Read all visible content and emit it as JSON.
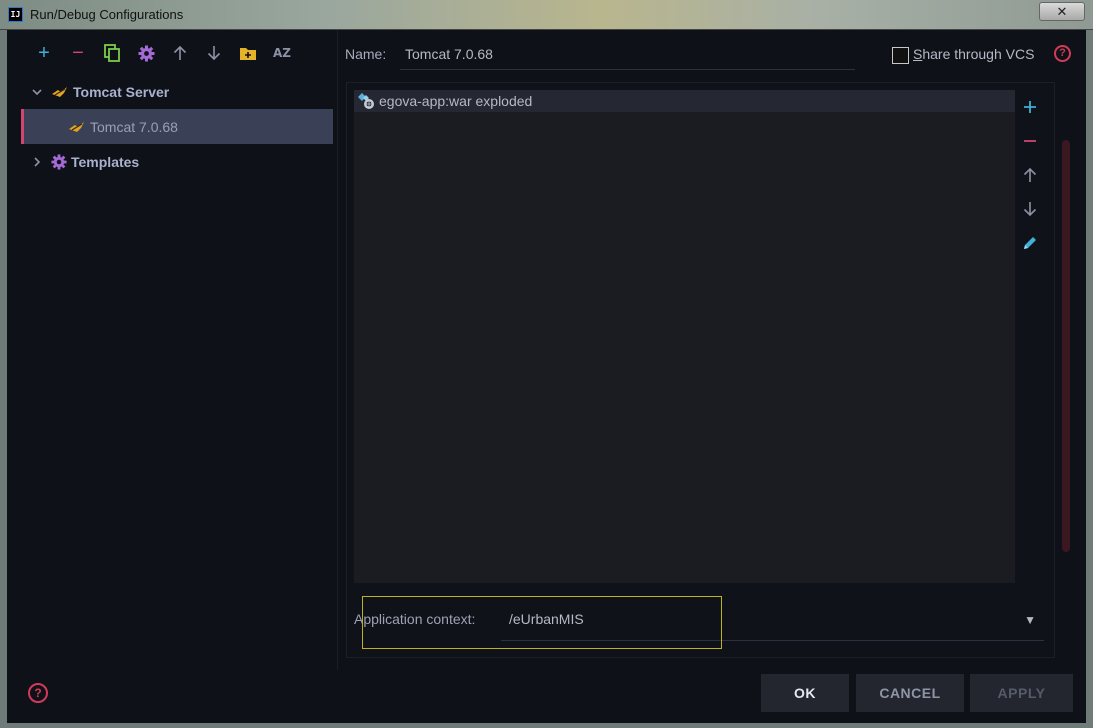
{
  "window": {
    "app_icon": "IJ",
    "title": "Run/Debug Configurations",
    "close_label": "✕"
  },
  "toolbar": {
    "items": [
      {
        "name": "add-icon",
        "glyph": "+",
        "color": "#3fb0d6"
      },
      {
        "name": "remove-icon",
        "glyph": "−",
        "color": "#d2456e"
      },
      {
        "name": "copy-icon",
        "color": "#7ecb4a"
      },
      {
        "name": "gear-icon",
        "color": "#a46bd6"
      },
      {
        "name": "arrow-up-icon",
        "color": "#8c92a6"
      },
      {
        "name": "arrow-down-icon",
        "color": "#8c92a6"
      },
      {
        "name": "folder-add-icon",
        "color": "#e6b228"
      },
      {
        "name": "sort-az-icon",
        "glyph": "AZ",
        "color": "#8c92a6"
      }
    ]
  },
  "tree": {
    "tomcat_group": "Tomcat Server",
    "tomcat_child": "Tomcat 7.0.68",
    "templates": "Templates"
  },
  "form": {
    "name_label": "Name:",
    "name_value": "Tomcat 7.0.68",
    "share_label_first": "S",
    "share_label_rest": "hare through VCS",
    "help_glyph": "?"
  },
  "deployment": {
    "artifacts": [
      "egova-app:war exploded"
    ]
  },
  "context": {
    "label": "Application context:",
    "value": "/eUrbanMIS",
    "arrow": "▼"
  },
  "buttons": {
    "ok": "OK",
    "cancel": "CANCEL",
    "apply": "APPLY"
  },
  "colors": {
    "accent_pink": "#d2456e",
    "accent_cyan": "#3fb0d6",
    "highlight": "#bdb31c"
  }
}
